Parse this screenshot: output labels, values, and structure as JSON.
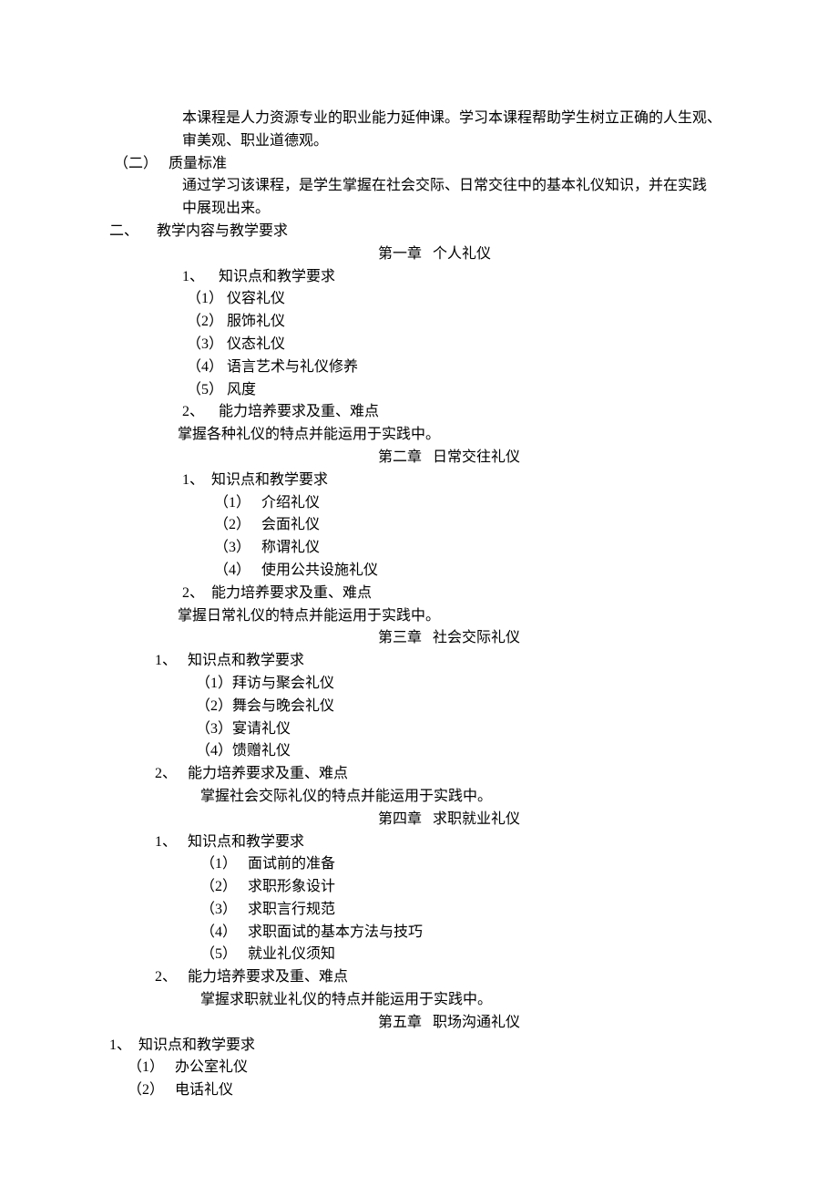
{
  "intro": {
    "l1": "本课程是人力资源专业的职业能力延伸课。学习本课程帮助学生树立正确的人生观、",
    "l2": "审美观、职业道德观。"
  },
  "quality": {
    "heading_num": "（二）",
    "heading_txt": "质量标准",
    "l1": "通过学习该课程，是学生掌握在社会交际、日常交往中的基本礼仪知识，并在实践",
    "l2": "中展现出来。"
  },
  "section2": {
    "num": "二、",
    "title": "教学内容与教学要求"
  },
  "ch1": {
    "title": "第一章   个人礼仪",
    "kp_num": "1、",
    "kp_txt": "知识点和教学要求",
    "p1": "（1） 仪容礼仪",
    "p2": "（2） 服饰礼仪",
    "p3": "（3） 仪态礼仪",
    "p4": "（4） 语言艺术与礼仪修养",
    "p5": "（5） 风度",
    "ab_num": "2、",
    "ab_txt": "能力培养要求及重、难点",
    "ab_body": "掌握各种礼仪的特点并能运用于实践中。"
  },
  "ch2": {
    "title": "第二章   日常交往礼仪",
    "kp_num": "1、",
    "kp_txt": "知识点和教学要求",
    "p1_num": "（1）",
    "p1_txt": "介绍礼仪",
    "p2_num": "（2）",
    "p2_txt": "会面礼仪",
    "p3_num": "（3）",
    "p3_txt": "称谓礼仪",
    "p4_num": "（4）",
    "p4_txt": "使用公共设施礼仪",
    "ab_num": "2、",
    "ab_txt": "能力培养要求及重、难点",
    "ab_body": "掌握日常礼仪的特点并能运用于实践中。"
  },
  "ch3": {
    "title": "第三章   社会交际礼仪",
    "kp_num": "1、",
    "kp_txt": "知识点和教学要求",
    "p1": "（1）拜访与聚会礼仪",
    "p2": "（2）舞会与晚会礼仪",
    "p3": "（3）宴请礼仪",
    "p4": "（4）馈赠礼仪",
    "ab_num": "2、",
    "ab_txt": "能力培养要求及重、难点",
    "ab_body": "掌握社会交际礼仪的特点并能运用于实践中。"
  },
  "ch4": {
    "title": "第四章   求职就业礼仪",
    "kp_num": "1、",
    "kp_txt": "知识点和教学要求",
    "p1_num": "（1）",
    "p1_txt": "面试前的准备",
    "p2_num": "（2）",
    "p2_txt": "求职形象设计",
    "p3_num": "（3）",
    "p3_txt": "求职言行规范",
    "p4_num": "（4）",
    "p4_txt": "求职面试的基本方法与技巧",
    "p5_num": "（5）",
    "p5_txt": "就业礼仪须知",
    "ab_num": "2、",
    "ab_txt": "能力培养要求及重、难点",
    "ab_body": "掌握求职就业礼仪的特点并能运用于实践中。"
  },
  "ch5": {
    "title": "第五章   职场沟通礼仪",
    "kp_num": "1、",
    "kp_txt": "知识点和教学要求",
    "p1_num": "（1）",
    "p1_txt": "办公室礼仪",
    "p2_num": "（2）",
    "p2_txt": "电话礼仪"
  }
}
